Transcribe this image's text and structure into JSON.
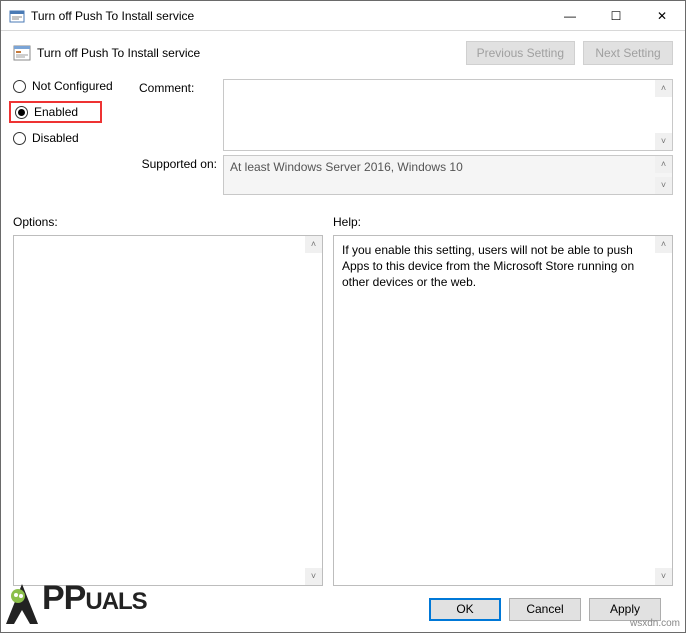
{
  "window": {
    "title": "Turn off Push To Install service",
    "controls": {
      "min": "—",
      "max": "☐",
      "close": "✕"
    }
  },
  "header": {
    "title": "Turn off Push To Install service",
    "prev_label": "Previous Setting",
    "next_label": "Next Setting"
  },
  "radios": {
    "not_configured": "Not Configured",
    "enabled": "Enabled",
    "disabled": "Disabled",
    "selected": "enabled"
  },
  "labels": {
    "comment": "Comment:",
    "supported_on": "Supported on:",
    "options": "Options:",
    "help": "Help:"
  },
  "supported_text": "At least Windows Server 2016, Windows 10",
  "help_text": "If you enable this setting, users will not be able to push Apps to this device from the Microsoft Store running on other devices or the web.",
  "buttons": {
    "ok": "OK",
    "cancel": "Cancel",
    "apply": "Apply"
  },
  "branding": {
    "watermark": "wsxdn.com",
    "logo_text_1": "PP",
    "logo_text_2": "UALS"
  }
}
